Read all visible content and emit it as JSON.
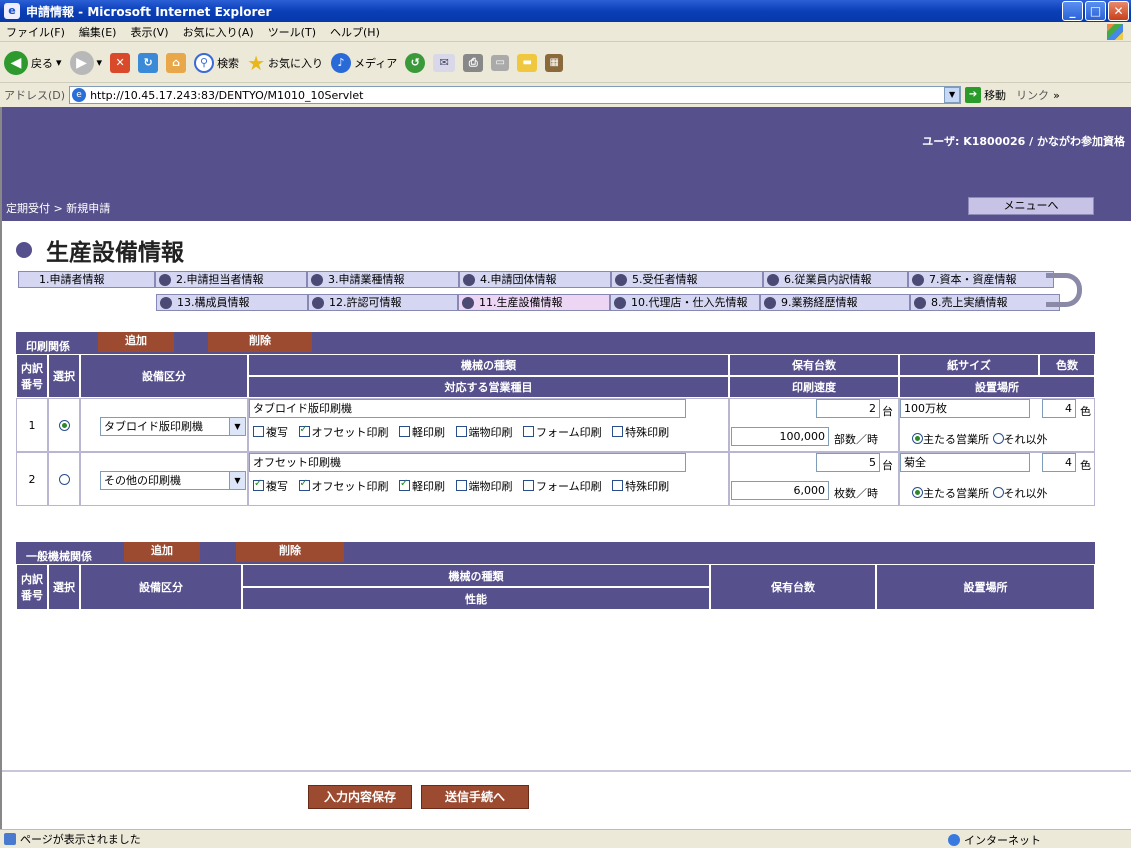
{
  "window": {
    "title": "申請情報 - Microsoft Internet Explorer"
  },
  "menu": [
    "ファイル(F)",
    "編集(E)",
    "表示(V)",
    "お気に入り(A)",
    "ツール(T)",
    "ヘルプ(H)"
  ],
  "toolbar": {
    "back": "戻る",
    "search": "検索",
    "favorites": "お気に入り",
    "media": "メディア"
  },
  "address": {
    "label": "アドレス(D)",
    "url": "http://10.45.17.243:83/DENTYO/M1010_10Servlet",
    "go": "移動",
    "links": "リンク"
  },
  "header": {
    "user": "ユーザ: K1800026 / かながわ参加資格",
    "breadcrumb": "定期受付 > 新規申請",
    "menu_button": "メニューへ"
  },
  "page_title": "生産設備情報",
  "tabs": [
    "1.申請者情報",
    "2.申請担当者情報",
    "3.申請業種情報",
    "4.申請団体情報",
    "5.受任者情報",
    "6.従業員内訳情報",
    "7.資本・資産情報",
    "13.構成員情報",
    "12.許認可情報",
    "11.生産設備情報",
    "10.代理店・仕入先情報",
    "9.業務経歴情報",
    "8.売上実績情報"
  ],
  "print_section": {
    "label": "印刷関係",
    "add": "追加",
    "delete": "削除",
    "headers": {
      "no": "内訳番号",
      "select": "選択",
      "category": "設備区分",
      "machine_type": "機械の種類",
      "business": "対応する営業種目",
      "count": "保有台数",
      "speed": "印刷速度",
      "paper": "紙サイズ",
      "place": "設置場所",
      "colors": "色数"
    },
    "rows": [
      {
        "no": "1",
        "selected": true,
        "category": "タブロイド版印刷機",
        "machine": "タブロイド版印刷機",
        "count": "2",
        "count_unit": "台",
        "paper": "100万枚",
        "colors": "4",
        "colors_unit": "色",
        "checks": [
          {
            "label": "複写",
            "on": false
          },
          {
            "label": "オフセット印刷",
            "on": true
          },
          {
            "label": "軽印刷",
            "on": false
          },
          {
            "label": "端物印刷",
            "on": false
          },
          {
            "label": "フォーム印刷",
            "on": false
          },
          {
            "label": "特殊印刷",
            "on": false
          }
        ],
        "speed": "100,000",
        "speed_unit": "部数／時",
        "place_main": "主たる営業所",
        "place_other": "それ以外",
        "place_main_on": true
      },
      {
        "no": "2",
        "selected": false,
        "category": "その他の印刷機",
        "machine": "オフセット印刷機",
        "count": "5",
        "count_unit": "台",
        "paper": "菊全",
        "colors": "4",
        "colors_unit": "色",
        "checks": [
          {
            "label": "複写",
            "on": true
          },
          {
            "label": "オフセット印刷",
            "on": true
          },
          {
            "label": "軽印刷",
            "on": true
          },
          {
            "label": "端物印刷",
            "on": false
          },
          {
            "label": "フォーム印刷",
            "on": false
          },
          {
            "label": "特殊印刷",
            "on": false
          }
        ],
        "speed": "6,000",
        "speed_unit": "枚数／時",
        "place_main": "主たる営業所",
        "place_other": "それ以外",
        "place_main_on": true
      }
    ]
  },
  "general_section": {
    "label": "一般機械関係",
    "add": "追加",
    "delete": "削除",
    "headers": {
      "no": "内訳番号",
      "select": "選択",
      "category": "設備区分",
      "machine_type": "機械の種類",
      "performance": "性能",
      "count": "保有台数",
      "place": "設置場所"
    }
  },
  "bottom": {
    "save": "入力内容保存",
    "send": "送信手続へ"
  },
  "status": {
    "text": "ページが表示されました",
    "zone": "インターネット"
  }
}
